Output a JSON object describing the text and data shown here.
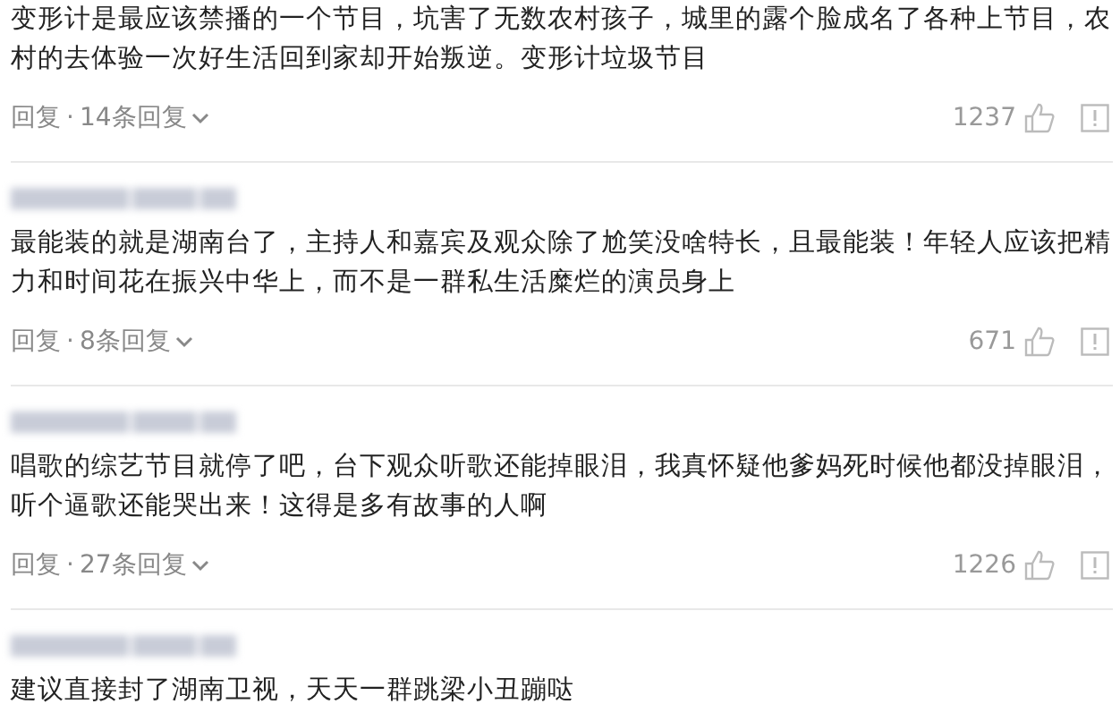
{
  "comments": [
    {
      "author_blurred": false,
      "text": "变形计是最应该禁播的一个节目，坑害了无数农村孩子，城里的露个脸成名了各种上节目，农村的去体验一次好生活回到家却开始叛逆。变形计垃圾节目",
      "actions": {
        "reply": "回复",
        "separator": "·",
        "replies": "14条回复",
        "likes": "1237"
      }
    },
    {
      "author_blurred": true,
      "text": "最能装的就是湖南台了，主持人和嘉宾及观众除了尬笑没啥特长，且最能装！年轻人应该把精力和时间花在振兴中华上，而不是一群私生活糜烂的演员身上",
      "actions": {
        "reply": "回复",
        "separator": "·",
        "replies": "8条回复",
        "likes": "671"
      }
    },
    {
      "author_blurred": true,
      "text": "唱歌的综艺节目就停了吧，台下观众听歌还能掉眼泪，我真怀疑他爹妈死时候他都没掉眼泪，听个逼歌还能哭出来！这得是多有故事的人啊",
      "actions": {
        "reply": "回复",
        "separator": "·",
        "replies": "27条回复",
        "likes": "1226"
      }
    },
    {
      "author_blurred": true,
      "text": "建议直接封了湖南卫视，天天一群跳梁小丑蹦哒"
    }
  ]
}
